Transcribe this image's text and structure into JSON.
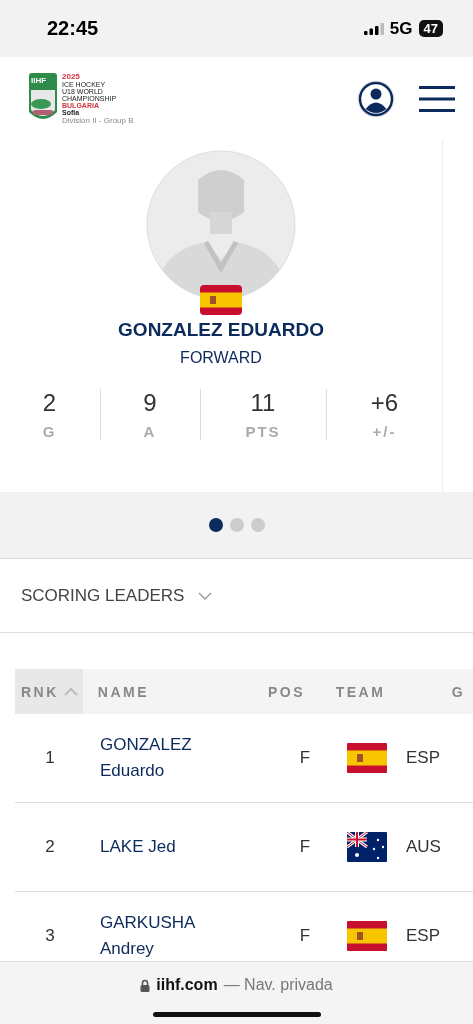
{
  "status_bar": {
    "time": "22:45",
    "network": "5G",
    "battery": "47"
  },
  "header": {
    "logo": {
      "badge": "IIHF",
      "year": "2025",
      "lines": [
        "ICE HOCKEY",
        "U18 WORLD",
        "CHAMPIONSHIP"
      ],
      "country": "BULGARIA",
      "city": "Sofia",
      "division": "Division II - Group B"
    }
  },
  "player": {
    "name": "GONZALEZ EDUARDO",
    "position": "FORWARD",
    "flag": {
      "kind": "esp"
    },
    "stats": [
      {
        "value": "2",
        "label": "G"
      },
      {
        "value": "9",
        "label": "A"
      },
      {
        "value": "11",
        "label": "PTS"
      },
      {
        "value": "+6",
        "label": "+/-"
      }
    ]
  },
  "carousel": {
    "dots": [
      {
        "selected": true
      },
      {
        "selected": false
      },
      {
        "selected": false
      }
    ]
  },
  "dropdown": {
    "label": "SCORING LEADERS"
  },
  "table": {
    "columns": [
      {
        "label": "RNK",
        "selected": true
      },
      {
        "label": "NAME",
        "selected": false
      },
      {
        "label": "POS",
        "selected": false
      },
      {
        "label": "TEAM",
        "selected": false
      },
      {
        "label": "G",
        "selected": false
      }
    ],
    "rows": [
      {
        "rank": "1",
        "name": "GONZALEZ Eduardo",
        "pos": "F",
        "flag": {
          "kind": "esp"
        },
        "team": "ESP"
      },
      {
        "rank": "2",
        "name": "LAKE Jed",
        "pos": "F",
        "flag": {
          "kind": "aus"
        },
        "team": "AUS"
      },
      {
        "rank": "3",
        "name": "GARKUSHA Andrey",
        "pos": "F",
        "flag": {
          "kind": "esp"
        },
        "team": "ESP"
      }
    ]
  },
  "browser_bar": {
    "domain": "iihf.com",
    "suffix": "— Nav. privada"
  }
}
